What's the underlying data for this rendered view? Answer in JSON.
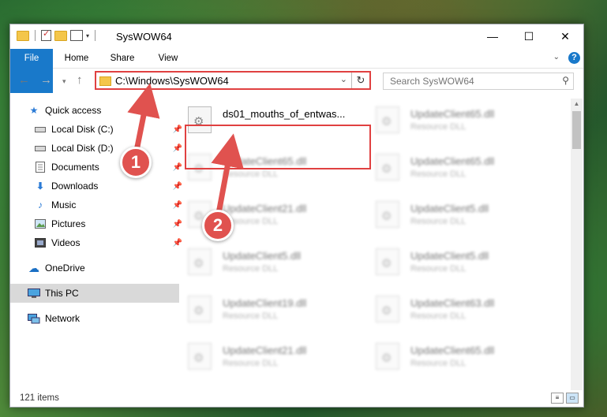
{
  "window": {
    "title": "SysWOW64",
    "controls": {
      "minimize": "—",
      "maximize": "☐",
      "close": "✕"
    }
  },
  "ribbon": {
    "tabs": [
      "File",
      "Home",
      "Share",
      "View"
    ],
    "help": "?"
  },
  "navigation": {
    "address_path": "C:\\Windows\\SysWOW64",
    "search_placeholder": "Search SysWOW64"
  },
  "sidebar": {
    "items": [
      {
        "label": "Quick access",
        "icon": "star-icon"
      },
      {
        "label": "Local Disk (C:)",
        "icon": "drive-icon",
        "pinned": true
      },
      {
        "label": "Local Disk (D:)",
        "icon": "drive-icon",
        "pinned": true
      },
      {
        "label": "Documents",
        "icon": "documents-icon",
        "pinned": true
      },
      {
        "label": "Downloads",
        "icon": "download-icon",
        "pinned": true
      },
      {
        "label": "Music",
        "icon": "music-icon",
        "pinned": true
      },
      {
        "label": "Pictures",
        "icon": "pictures-icon",
        "pinned": true
      },
      {
        "label": "Videos",
        "icon": "video-icon",
        "pinned": true
      },
      {
        "label": "OneDrive",
        "icon": "cloud-icon"
      },
      {
        "label": "This PC",
        "icon": "computer-icon",
        "selected": true
      },
      {
        "label": "Network",
        "icon": "network-icon"
      }
    ]
  },
  "files": [
    {
      "name": "ds01_mouths_of_entwas...",
      "type": ""
    },
    {
      "name": "UpdateClient65.dll",
      "type": "Resource DLL"
    },
    {
      "name": "UpdateClient65.dll",
      "type": "Resource DLL"
    },
    {
      "name": "UpdateClient65.dll",
      "type": "Resource DLL"
    },
    {
      "name": "UpdateClient21.dll",
      "type": "Resource DLL"
    },
    {
      "name": "UpdateClient5.dll",
      "type": "Resource DLL"
    },
    {
      "name": "UpdateClient5.dll",
      "type": "Resource DLL"
    },
    {
      "name": "UpdateClient5.dll",
      "type": "Resource DLL"
    },
    {
      "name": "UpdateClient19.dll",
      "type": "Resource DLL"
    },
    {
      "name": "UpdateClient63.dll",
      "type": "Resource DLL"
    },
    {
      "name": "UpdateClient21.dll",
      "type": "Resource DLL"
    },
    {
      "name": "UpdateClient65.dll",
      "type": "Resource DLL"
    }
  ],
  "status": {
    "item_count": "121 items"
  },
  "annotations": {
    "step1": "1",
    "step2": "2",
    "highlight_color": "#e04141"
  }
}
